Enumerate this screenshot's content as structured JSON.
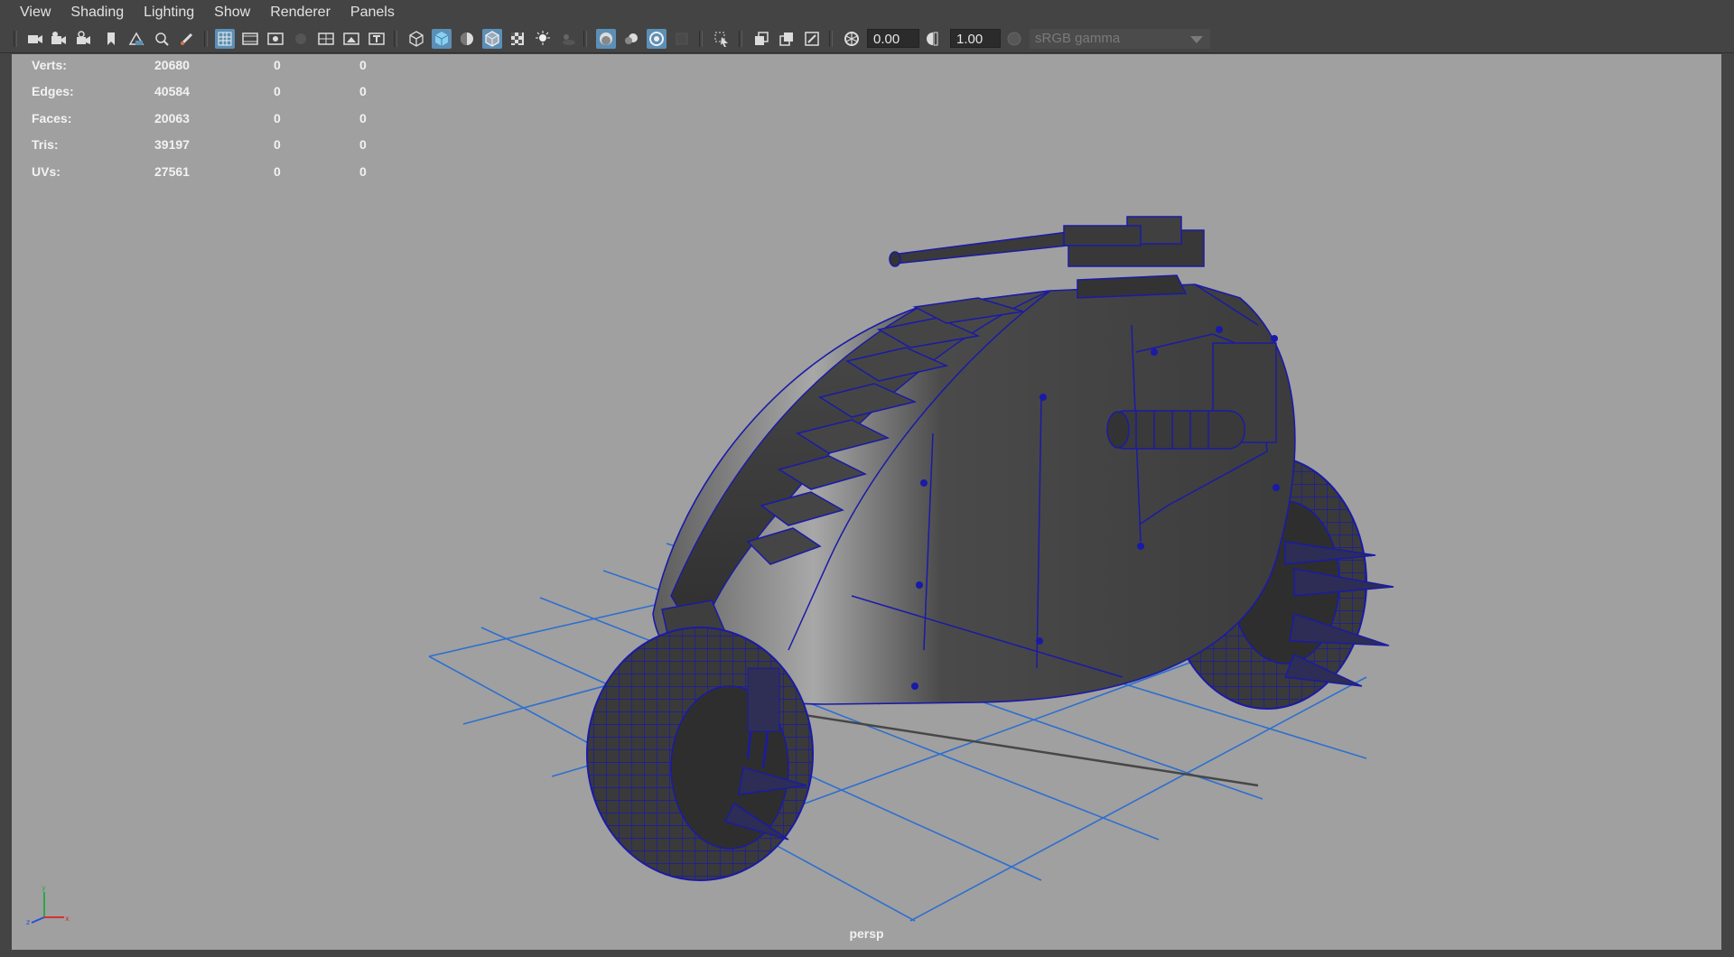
{
  "menu": [
    "View",
    "Shading",
    "Lighting",
    "Show",
    "Renderer",
    "Panels"
  ],
  "toolbar": {
    "exposure_value": "0.00",
    "gamma_value": "1.00",
    "color_space": "sRGB gamma",
    "icons": [
      "camera-icon",
      "camera-attributes-icon",
      "camera-lock-icon",
      "bookmark-icon",
      "image-plane-icon",
      "pan-zoom-icon",
      "grease-pencil-icon",
      "grid-icon",
      "film-gate-icon",
      "resolution-gate-icon",
      "gate-mask-icon",
      "field-chart-icon",
      "safe-action-icon",
      "safe-title-icon",
      "wireframe-icon",
      "smooth-shade-icon",
      "default-material-icon",
      "wireframe-on-shaded-icon",
      "textured-icon",
      "lights-icon",
      "shadows-icon",
      "screen-space-ao-icon",
      "motion-blur-icon",
      "anti-aliasing-icon",
      "depth-of-field-icon",
      "isolate-select-icon",
      "xray-icon",
      "xray-joints-icon",
      "xray-components-icon",
      "exposure-icon",
      "gamma-icon",
      "color-management-icon"
    ],
    "colors": {
      "active": "#5c8fb5",
      "background": "#444444",
      "field": "#2b2b2b"
    }
  },
  "hud": {
    "rows": [
      {
        "label": "Verts:",
        "v1": "20680",
        "v2": "0",
        "v3": "0"
      },
      {
        "label": "Edges:",
        "v1": "40584",
        "v2": "0",
        "v3": "0"
      },
      {
        "label": "Faces:",
        "v1": "20063",
        "v2": "0",
        "v3": "0"
      },
      {
        "label": "Tris:",
        "v1": "39197",
        "v2": "0",
        "v3": "0"
      },
      {
        "label": "UVs:",
        "v1": "27561",
        "v2": "0",
        "v3": "0"
      }
    ]
  },
  "viewport": {
    "camera_label": "persp",
    "background_color": "#a0a0a0",
    "wireframe_color": "#1a1aa8",
    "grid_color": "#2e6fcf"
  }
}
